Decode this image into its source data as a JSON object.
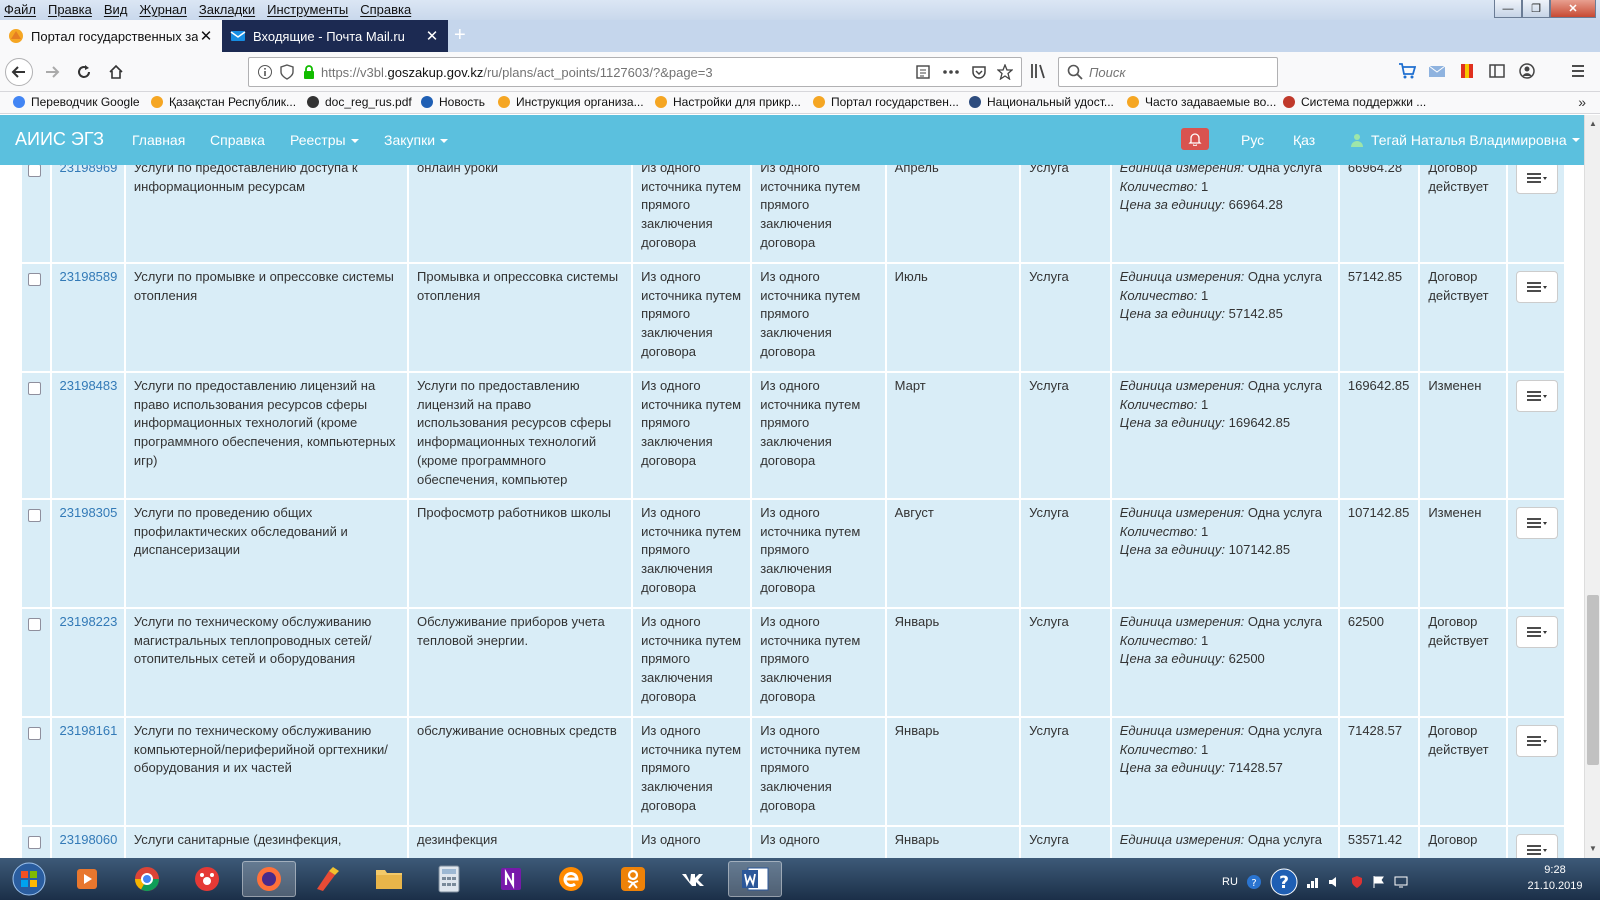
{
  "browser": {
    "menu": [
      "Файл",
      "Правка",
      "Вид",
      "Журнал",
      "Закладки",
      "Инструменты",
      "Справка"
    ],
    "tabs": [
      {
        "title": "Портал государственных закупок",
        "active": true
      },
      {
        "title": "Входящие - Почта Mail.ru",
        "active": false
      }
    ],
    "url_prefix": "https://v3bl.",
    "url_domain": "goszakup.gov.kz",
    "url_path": "/ru/plans/act_points/1127603/?&page=3",
    "search_placeholder": "Поиск",
    "bookmarks": [
      "Переводчик Google",
      "Қазақстан Республик...",
      "doc_reg_rus.pdf",
      "Новость",
      "Инструкция организа...",
      "Настройки для прикр...",
      "Портал государствен...",
      "Национальный удост...",
      "Часто задаваемые во...",
      "Система поддержки ..."
    ]
  },
  "site": {
    "brand": "АИИС ЭГЗ",
    "nav": [
      {
        "label": "Главная",
        "dropdown": false
      },
      {
        "label": "Справка",
        "dropdown": false
      },
      {
        "label": "Реестры",
        "dropdown": true
      },
      {
        "label": "Закупки",
        "dropdown": true
      }
    ],
    "lang_ru": "Рус",
    "lang_kz": "Қаз",
    "user": "Тегай Наталья Владимировна"
  },
  "labels": {
    "unit": "Единица измерения:",
    "qty": "Количество:",
    "price": "Цена за единицу:"
  },
  "rows": [
    {
      "id": "23198969",
      "name": "Услуги по предоставлению доступа к информационным ресурсам",
      "desc": "онлайн уроки",
      "method1": "Из одного источника путем прямого заключения договора",
      "method2": "Из одного источника путем прямого заключения договора",
      "month": "Апрель",
      "type": "Услуга",
      "unit": "Одна услуга",
      "qty": "1",
      "price": "66964.28",
      "sum": "66964.28",
      "status": "Договор действует"
    },
    {
      "id": "23198589",
      "name": "Услуги по промывке и опрессовке системы отопления",
      "desc": "Промывка и опрессовка системы отопления",
      "method1": "Из одного источника путем прямого заключения договора",
      "method2": "Из одного источника путем прямого заключения договора",
      "month": "Июль",
      "type": "Услуга",
      "unit": "Одна услуга",
      "qty": "1",
      "price": "57142.85",
      "sum": "57142.85",
      "status": "Договор действует"
    },
    {
      "id": "23198483",
      "name": "Услуги по предоставлению лицензий на право использования ресурсов сферы информационных технологий (кроме программного обеспечения, компьютерных игр)",
      "desc": "Услуги по предоставлению лицензий на право использования ресурсов сферы информационных технологий (кроме программного обеспечения, компьютер",
      "method1": "Из одного источника путем прямого заключения договора",
      "method2": "Из одного источника путем прямого заключения договора",
      "month": "Март",
      "type": "Услуга",
      "unit": "Одна услуга",
      "qty": "1",
      "price": "169642.85",
      "sum": "169642.85",
      "status": "Изменен"
    },
    {
      "id": "23198305",
      "name": "Услуги по проведению общих профилактических обследований и диспансеризации",
      "desc": "Профосмотр работников школы",
      "method1": "Из одного источника путем прямого заключения договора",
      "method2": "Из одного источника путем прямого заключения договора",
      "month": "Август",
      "type": "Услуга",
      "unit": "Одна услуга",
      "qty": "1",
      "price": "107142.85",
      "sum": "107142.85",
      "status": "Изменен"
    },
    {
      "id": "23198223",
      "name": "Услуги по техническому обслуживанию магистральных теплопроводных сетей/отопительных сетей и оборудования",
      "desc": "Обслуживание приборов учета тепловой энергии.",
      "method1": "Из одного источника путем прямого заключения договора",
      "method2": "Из одного источника путем прямого заключения договора",
      "month": "Январь",
      "type": "Услуга",
      "unit": "Одна услуга",
      "qty": "1",
      "price": "62500",
      "sum": "62500",
      "status": "Договор действует"
    },
    {
      "id": "23198161",
      "name": "Услуги по техническому обслуживанию компьютерной/периферийной оргтехники/оборудования и их частей",
      "desc": "обслуживание основных средств",
      "method1": "Из одного источника путем прямого заключения договора",
      "method2": "Из одного источника путем прямого заключения договора",
      "month": "Январь",
      "type": "Услуга",
      "unit": "Одна услуга",
      "qty": "1",
      "price": "71428.57",
      "sum": "71428.57",
      "status": "Договор действует"
    },
    {
      "id": "23198060",
      "name": "Услуги санитарные (дезинфекция,",
      "desc": "дезинфекция",
      "method1": "Из одного",
      "method2": "Из одного",
      "month": "Январь",
      "type": "Услуга",
      "unit": "Одна услуга",
      "qty": "",
      "price": "",
      "sum": "53571.42",
      "status": "Договор"
    }
  ],
  "taskbar": {
    "lang": "RU",
    "time": "9:28",
    "date": "21.10.2019"
  }
}
